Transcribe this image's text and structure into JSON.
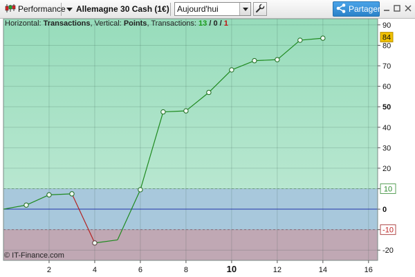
{
  "toolbar": {
    "performance_label": "Performance",
    "instrument_label": "Allemagne 30 Cash (1€)",
    "period_value": "Aujourd'hui",
    "share_label": "Partager"
  },
  "info_bar": {
    "horizontal_prefix": "Horizontal:",
    "horizontal_value": "Transactions",
    "vertical_prefix": ", Vertical:",
    "vertical_value": "Points",
    "transactions_prefix": ", Transactions:",
    "winning": "13",
    "sep1": " / ",
    "neutral": "0",
    "sep2": " / ",
    "losing": "1"
  },
  "copyright": "© IT-Finance.com",
  "colors": {
    "profit_zone": "#a6e0c4",
    "neutral_zone": "#a8c8dc",
    "loss_zone": "#c0a8b4",
    "up_line": "#1f8a1f",
    "down_line": "#b22222",
    "zero_line": "#2233aa",
    "current_tag": "#f0c000"
  },
  "chart_data": {
    "type": "line",
    "xlabel": "",
    "ylabel": "",
    "x": [
      0,
      1,
      2,
      3,
      4,
      5,
      6,
      7,
      8,
      9,
      10,
      11,
      12,
      13,
      14
    ],
    "y": [
      0,
      2,
      7,
      7.5,
      -16.5,
      -15,
      9.5,
      47.5,
      48,
      57,
      68,
      72.5,
      73,
      82.5,
      83.5
    ],
    "markers": [
      false,
      true,
      true,
      true,
      true,
      false,
      true,
      true,
      true,
      true,
      true,
      true,
      true,
      true,
      true
    ],
    "xlim": [
      0,
      16.4
    ],
    "ylim": [
      -25,
      93
    ],
    "x_ticks": [
      2,
      4,
      6,
      8,
      10,
      12,
      14,
      16
    ],
    "x_tick_bold": 10,
    "y_ticks": [
      -20,
      -10,
      0,
      10,
      20,
      30,
      40,
      50,
      60,
      70,
      80,
      90
    ],
    "y_tick_bold": [
      0,
      50
    ],
    "upper_threshold": 10,
    "lower_threshold": -10,
    "current_value": 84,
    "grid": true
  }
}
